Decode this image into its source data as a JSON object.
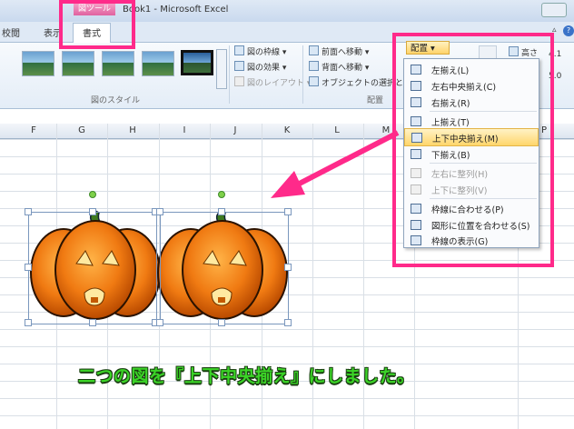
{
  "window": {
    "tool_group": "図ツール",
    "title": "Book1 - Microsoft Excel"
  },
  "tabs": [
    {
      "label": "校閲"
    },
    {
      "label": "表示"
    },
    {
      "label": "書式",
      "active": true
    }
  ],
  "ribbon": {
    "picture_styles_label": "図のスタイル",
    "picture_border": "図の枠線 ▾",
    "picture_effects": "図の効果 ▾",
    "picture_layout": "図のレイアウト ▾",
    "bring_forward": "前面へ移動 ▾",
    "send_backward": "背面へ移動 ▾",
    "selection_pane": "オブジェクトの選択と表示",
    "arrange_label": "配置",
    "align_button": "配置 ▾",
    "height_label": "高さ",
    "height_value": "4.1",
    "width_value": "5.0"
  },
  "columns": [
    "F",
    "G",
    "H",
    "I",
    "J",
    "K",
    "L",
    "M",
    "P"
  ],
  "align_menu": {
    "items": [
      {
        "label": "左揃え(L)",
        "disabled": false
      },
      {
        "label": "左右中央揃え(C)",
        "disabled": false
      },
      {
        "label": "右揃え(R)",
        "disabled": false
      },
      {
        "label": "上揃え(T)",
        "disabled": false
      },
      {
        "label": "上下中央揃え(M)",
        "disabled": false,
        "highlighted": true
      },
      {
        "label": "下揃え(B)",
        "disabled": false
      },
      {
        "label": "左右に整列(H)",
        "disabled": true
      },
      {
        "label": "上下に整列(V)",
        "disabled": true
      },
      {
        "label": "枠線に合わせる(P)",
        "disabled": false
      },
      {
        "label": "図形に位置を合わせる(S)",
        "disabled": false
      },
      {
        "label": "枠線の表示(G)",
        "disabled": false
      }
    ]
  },
  "caption": "二つの図を『上下中央揃え』にしました。",
  "colors": {
    "highlight_pink": "#ff2a8a",
    "caption_green": "#3bd427",
    "pumpkin_orange": "#f07a12"
  }
}
